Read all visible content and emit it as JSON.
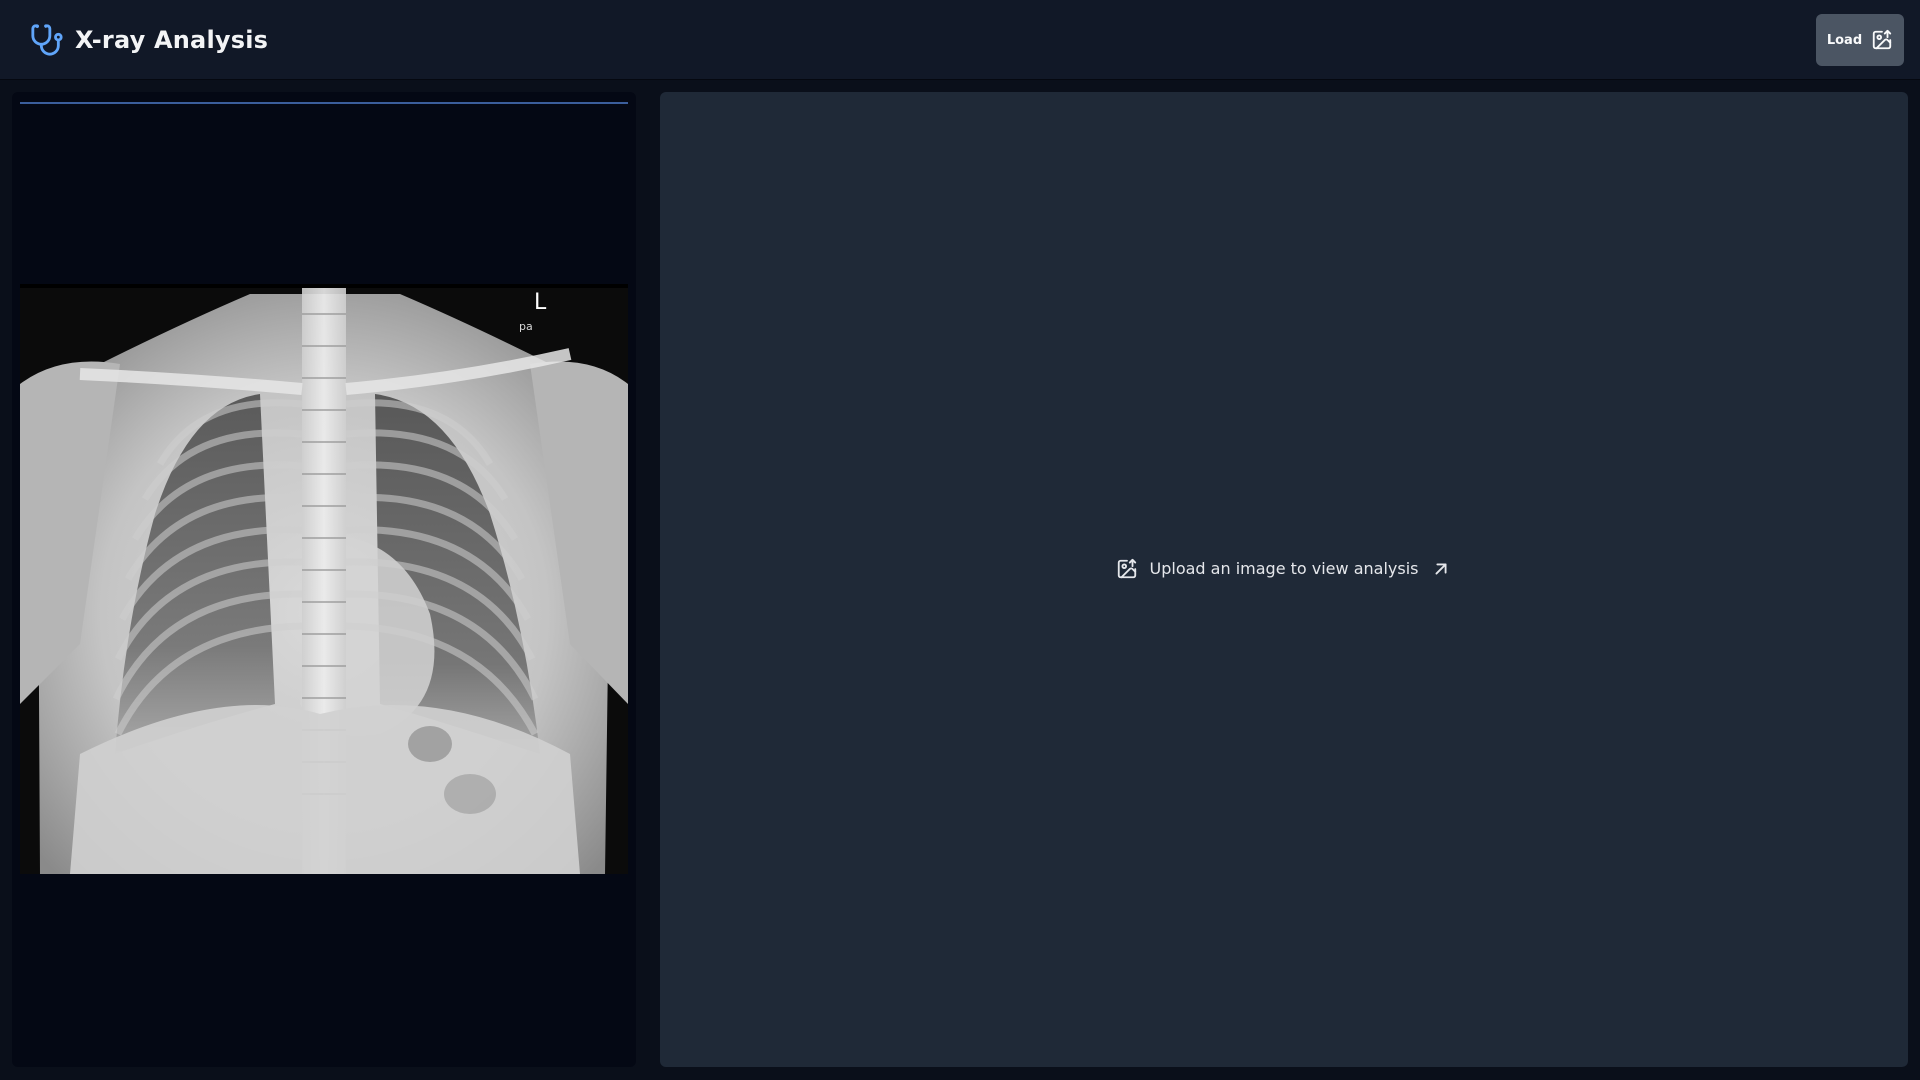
{
  "app": {
    "title": "X-ray Analysis",
    "brand_icon": "stethoscope-icon"
  },
  "toolbar": {
    "load_label": "Load",
    "load_icon": "image-upload-icon"
  },
  "viewer": {
    "xray_marker_side": "L",
    "xray_marker_view": "pa"
  },
  "analysis": {
    "empty_message": "Upload an image to view analysis",
    "empty_icon": "image-upload-icon",
    "arrow_icon": "arrow-up-right-icon"
  },
  "colors": {
    "header_bg": "#111827",
    "panel_bg": "#1f2937",
    "viewer_bg": "#040814",
    "accent": "#60a5fa",
    "button_bg": "#4b5563"
  }
}
